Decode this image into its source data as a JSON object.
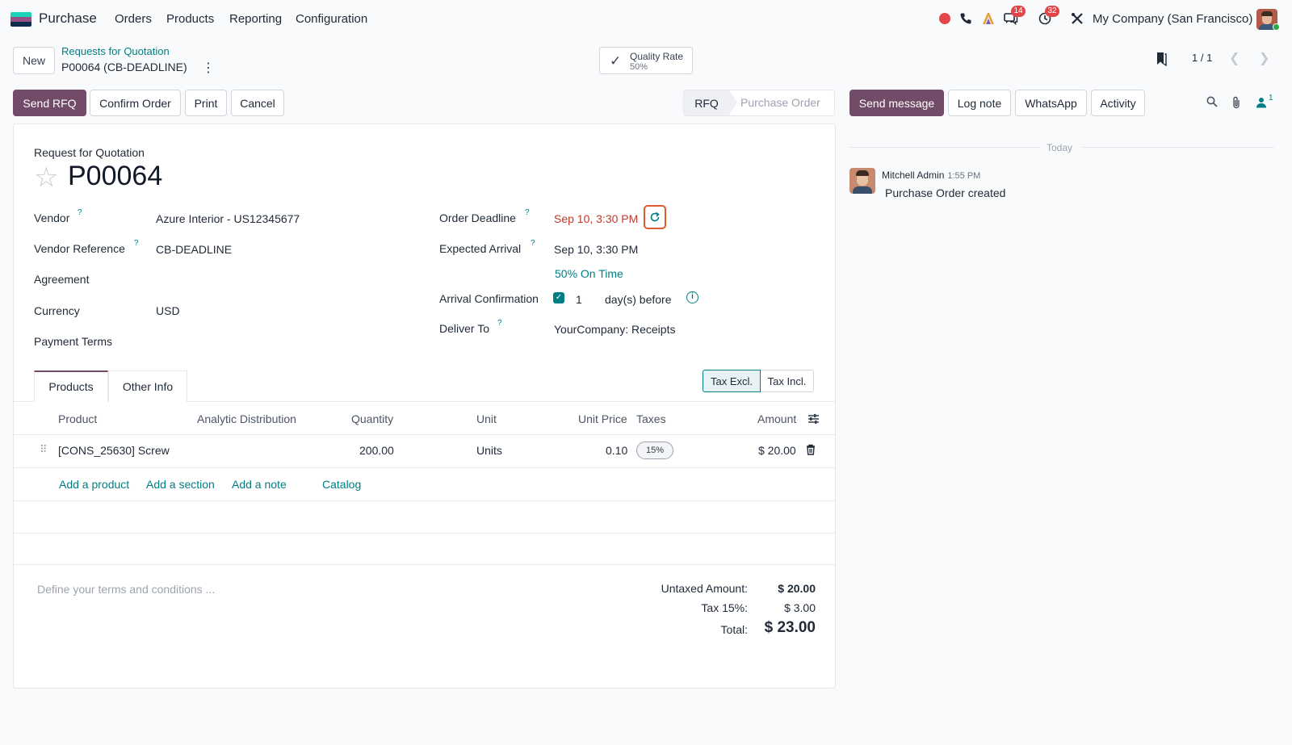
{
  "nav": {
    "app_name": "Purchase",
    "menu": [
      "Orders",
      "Products",
      "Reporting",
      "Configuration"
    ],
    "messages_badge": "14",
    "activities_badge": "32",
    "company": "My Company (San Francisco)"
  },
  "control": {
    "new_label": "New",
    "breadcrumb_parent": "Requests for Quotation",
    "breadcrumb_current": "P00064 (CB-DEADLINE)",
    "quality_label": "Quality Rate",
    "quality_value": "50%",
    "pager": "1 / 1"
  },
  "actions": {
    "send_rfq": "Send RFQ",
    "confirm_order": "Confirm Order",
    "print": "Print",
    "cancel": "Cancel"
  },
  "status": {
    "current": "RFQ",
    "next": "Purchase Order"
  },
  "chatter_actions": {
    "send_message": "Send message",
    "log_note": "Log note",
    "whatsapp": "WhatsApp",
    "activity": "Activity",
    "followers_count": "1"
  },
  "form": {
    "subtitle": "Request for Quotation",
    "name": "P00064",
    "vendor_label": "Vendor",
    "vendor_value": "Azure Interior - US12345677",
    "vendor_ref_label": "Vendor Reference",
    "vendor_ref_value": "CB-DEADLINE",
    "agreement_label": "Agreement",
    "currency_label": "Currency",
    "currency_value": "USD",
    "payment_terms_label": "Payment Terms",
    "deadline_label": "Order Deadline",
    "deadline_value": "Sep 10, 3:30 PM",
    "expected_label": "Expected Arrival",
    "expected_value": "Sep 10, 3:30 PM",
    "on_time": "50% On Time",
    "arrival_conf_label": "Arrival Confirmation",
    "arrival_conf_days": "1",
    "arrival_conf_suffix": "day(s) before",
    "deliver_label": "Deliver To",
    "deliver_value": "YourCompany: Receipts",
    "help_mark": "?"
  },
  "tabs": {
    "products": "Products",
    "other_info": "Other Info",
    "tax_excl": "Tax Excl.",
    "tax_incl": "Tax Incl."
  },
  "table": {
    "headers": {
      "product": "Product",
      "analytic": "Analytic Distribution",
      "quantity": "Quantity",
      "unit": "Unit",
      "unit_price": "Unit Price",
      "taxes": "Taxes",
      "amount": "Amount"
    },
    "rows": [
      {
        "product": "[CONS_25630] Screw",
        "quantity": "200.00",
        "unit": "Units",
        "unit_price": "0.10",
        "taxes": "15%",
        "amount": "$ 20.00"
      }
    ],
    "add_product": "Add a product",
    "add_section": "Add a section",
    "add_note": "Add a note",
    "catalog": "Catalog"
  },
  "totals": {
    "terms_placeholder": "Define your terms and conditions ...",
    "untaxed_label": "Untaxed Amount:",
    "untaxed_value": "$ 20.00",
    "tax_label": "Tax 15%:",
    "tax_value": "$ 3.00",
    "total_label": "Total:",
    "total_value": "$ 23.00"
  },
  "chatter": {
    "date_separator": "Today",
    "author": "Mitchell Admin",
    "time": "1:55 PM",
    "message": "Purchase Order created"
  },
  "colors": {
    "brand": "#714b67",
    "teal": "#017e84",
    "deadline_red": "#c0392b",
    "badge_red": "#e4454a"
  }
}
